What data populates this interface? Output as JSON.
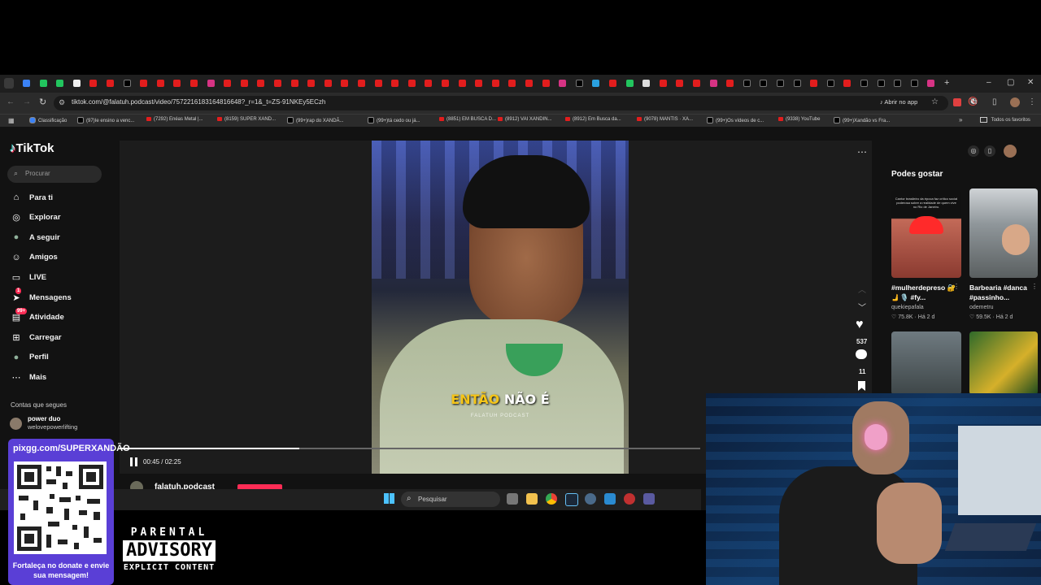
{
  "browser": {
    "url": "tiktok.com/@falatuh.podcast/video/7572216183164816648?_r=1&_t=ZS-91NKEy5ECzh",
    "open_in_app": "Abrir no app",
    "bookmarks": [
      {
        "label": "Classificação",
        "kind": "web"
      },
      {
        "label": "(97)Ie ensino a venc...",
        "kind": "tiktok"
      },
      {
        "label": "(7292) Enéas Metal |...",
        "kind": "youtube"
      },
      {
        "label": "(8159) SUPER XAND...",
        "kind": "youtube"
      },
      {
        "label": "(99+)rap do XANDÃ...",
        "kind": "tiktok"
      },
      {
        "label": "(99+)tá cedo ou já...",
        "kind": "tiktok"
      },
      {
        "label": "(8851) EM BUSCA D...",
        "kind": "youtube"
      },
      {
        "label": "(8912) VAI XANDIN...",
        "kind": "youtube"
      },
      {
        "label": "(8912) Em Busca da...",
        "kind": "youtube"
      },
      {
        "label": "(9078) MANTIS · XA...",
        "kind": "youtube"
      },
      {
        "label": "(99+)Os vídeos de c...",
        "kind": "tiktok"
      },
      {
        "label": "(9338) YouTube",
        "kind": "youtube"
      },
      {
        "label": "(99+)Xandão vs Fra...",
        "kind": "tiktok"
      }
    ],
    "all_bookmarks": "Todos os favoritos"
  },
  "tiktok": {
    "logo": "TikTok",
    "search_placeholder": "Procurar",
    "nav": [
      {
        "label": "Para ti",
        "icon": "home-icon"
      },
      {
        "label": "Explorar",
        "icon": "compass-icon"
      },
      {
        "label": "A seguir",
        "icon": "avatar-icon"
      },
      {
        "label": "Amigos",
        "icon": "friends-icon"
      },
      {
        "label": "LIVE",
        "icon": "live-icon"
      },
      {
        "label": "Mensagens",
        "icon": "send-icon",
        "badge": "1"
      },
      {
        "label": "Atividade",
        "icon": "inbox-icon",
        "badge": "99+"
      },
      {
        "label": "Carregar",
        "icon": "plus-square-icon"
      },
      {
        "label": "Perfil",
        "icon": "profile-icon"
      },
      {
        "label": "Mais",
        "icon": "more-icon"
      }
    ],
    "following_header": "Contas que segues",
    "following": [
      {
        "name": "power duo",
        "handle": "welovepowerlifting"
      }
    ],
    "video": {
      "caption_yellow": "ENTÃO",
      "caption_white": "NÃO É",
      "watermark": "FALATUH PODCAST",
      "time": "00:45 / 02:25",
      "progress": 0.31,
      "likes": "537",
      "comments": "11",
      "author": "falatuh.podcast"
    },
    "side": {
      "title": "Podes gostar",
      "cards": [
        {
          "title": "#mulherdepreso 🔐🫸🎙️ #fy...",
          "author": "quekiepafala",
          "views": "75.8K",
          "age": "Há 2 d",
          "thumb_text": "Cantor brasileiro da época faz crítico social poderosa sobre a realidade de quem vive no Rio de Janeiro."
        },
        {
          "title": "Barbearia #danca #passinho...",
          "author": "odemetru",
          "views": "59.5K",
          "age": "Há 2 d",
          "thumb_text": ""
        }
      ]
    }
  },
  "taskbar": {
    "search_placeholder": "Pesquisar"
  },
  "overlay": {
    "donate_url": "pixgg.com/SUPERXANDÃO",
    "donate_message": "Fortaleça no donate e envie sua mensagem!",
    "advisory_line1": "PARENTAL",
    "advisory_line2": "ADVISORY",
    "advisory_line3": "EXPLICIT CONTENT"
  },
  "colors": {
    "tiktok_accent": "#fe2c55",
    "donate_bg": "#5a3fd6",
    "caption_yellow": "#f5c518"
  }
}
